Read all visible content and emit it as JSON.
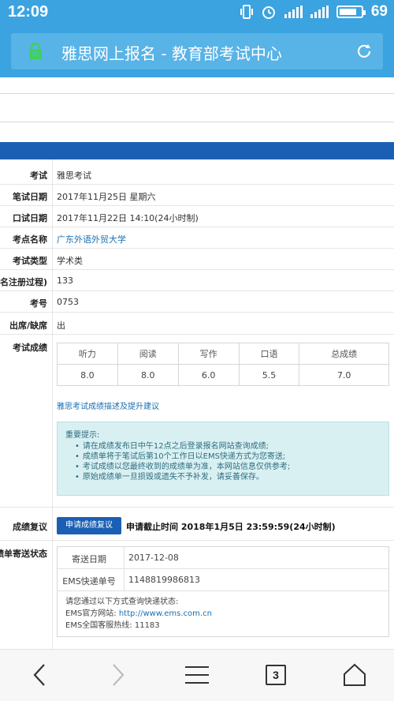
{
  "status_bar": {
    "time": "12:09",
    "battery": "69"
  },
  "browser": {
    "page_title": "雅思网上报名 - 教育部考试中心"
  },
  "info_rows": [
    {
      "label": "考试",
      "value": "雅思考试"
    },
    {
      "label": "笔试日期",
      "value": "2017年11月25日 星期六"
    },
    {
      "label": "口试日期",
      "value": "2017年11月22日 14:10(24小时制)"
    },
    {
      "label": "考点名称",
      "value": "广东外语外贸大学"
    },
    {
      "label": "考试类型",
      "value": "学术类"
    },
    {
      "label": "报名注册过程)",
      "value": "133"
    },
    {
      "label": "考号",
      "value": "0753"
    },
    {
      "label": "出席/缺席",
      "value": "出"
    },
    {
      "label": "考试成绩",
      "value": ""
    }
  ],
  "scores": {
    "headers": [
      "听力",
      "阅读",
      "写作",
      "口语",
      "总成绩"
    ],
    "values": [
      "8.0",
      "8.0",
      "6.0",
      "5.5",
      "7.0"
    ]
  },
  "score_desc_link": "雅思考试成绩描述及提升建议",
  "notice": {
    "title": "重要提示:",
    "items": [
      "请在成绩发布日中午12点之后登录报名网站查询成绩;",
      "成绩单将于笔试后第10个工作日以EMS快递方式为您寄送;",
      "考试成绩以您最终收到的成绩单为准，本网站信息仅供参考;",
      "原始成绩单一旦损毁或遗失不予补发，请妥善保存。"
    ]
  },
  "review": {
    "label": "成绩复议",
    "button": "申请成绩复议",
    "deadline": "申请截止时间 2018年1月5日 23:59:59(24小时制)"
  },
  "mailing": {
    "label": "绩单寄送状态",
    "rows": [
      {
        "key": "寄送日期",
        "value": "2017-12-08"
      },
      {
        "key": "EMS快递单号",
        "value": "1148819986813"
      }
    ],
    "info_line1": "请您通过以下方式查询快递状态:",
    "info_site_label": "EMS官方网站: ",
    "info_site_url": "http://www.ems.com.cn",
    "info_hotline": "EMS全国客服热线: 11183"
  },
  "bottom_nav": {
    "tab_count": "3"
  },
  "colors": {
    "accent": "#3aa3e0",
    "nav_blue": "#1a5fb4",
    "link": "#1a6fb0",
    "notice_bg": "#d9f0f3"
  },
  "icons": [
    "lock-icon",
    "refresh-icon",
    "back-icon",
    "forward-icon",
    "menu-icon",
    "home-icon"
  ]
}
